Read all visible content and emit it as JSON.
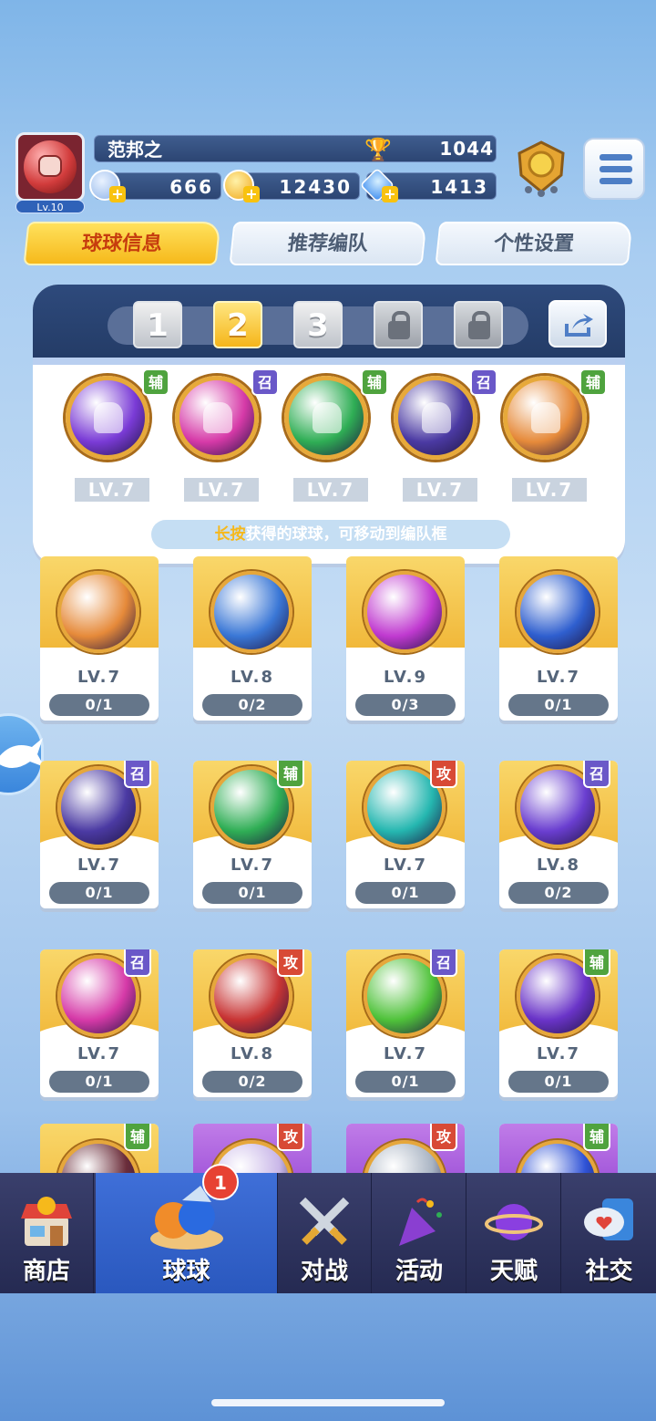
{
  "player": {
    "name": "范邦之",
    "level": "Lv.10",
    "trophies": "1044",
    "energy": "666",
    "gold": "12430",
    "gems": "1413"
  },
  "tabs": [
    {
      "label": "球球信息",
      "active": true
    },
    {
      "label": "推荐编队",
      "active": false
    },
    {
      "label": "个性设置",
      "active": false
    }
  ],
  "team": {
    "slots": [
      "1",
      "2",
      "3",
      "",
      ""
    ],
    "active_slot": "2",
    "balls": [
      {
        "tag": "辅",
        "level": "LV.7",
        "color": "#7a3bd6"
      },
      {
        "tag": "召",
        "level": "LV.7",
        "color": "#d63aa8"
      },
      {
        "tag": "辅",
        "level": "LV.7",
        "color": "#2fae55"
      },
      {
        "tag": "召",
        "level": "LV.7",
        "color": "#4b3aa3"
      },
      {
        "tag": "辅",
        "level": "LV.7",
        "color": "#e68a3a"
      }
    ],
    "hint_bold": "长按",
    "hint_rest": "获得的球球，可移动到编队框"
  },
  "cards": [
    {
      "tag": "",
      "level": "LV.7",
      "progress": "0/1",
      "color": "#e68a3a"
    },
    {
      "tag": "",
      "level": "LV.8",
      "progress": "0/2",
      "color": "#3a77d6"
    },
    {
      "tag": "",
      "level": "LV.9",
      "progress": "0/3",
      "color": "#c03ad0"
    },
    {
      "tag": "",
      "level": "LV.7",
      "progress": "0/1",
      "color": "#2f5fcf"
    },
    {
      "tag": "召",
      "level": "LV.7",
      "progress": "0/1",
      "color": "#4b3aa3"
    },
    {
      "tag": "辅",
      "level": "LV.7",
      "progress": "0/1",
      "color": "#2fae55"
    },
    {
      "tag": "攻",
      "level": "LV.7",
      "progress": "0/1",
      "color": "#25b7b0"
    },
    {
      "tag": "召",
      "level": "LV.8",
      "progress": "0/2",
      "color": "#6a3ed0"
    },
    {
      "tag": "召",
      "level": "LV.7",
      "progress": "0/1",
      "color": "#d63aa8"
    },
    {
      "tag": "攻",
      "level": "LV.8",
      "progress": "0/2",
      "color": "#c83434"
    },
    {
      "tag": "召",
      "level": "LV.7",
      "progress": "0/1",
      "color": "#4fc23a"
    },
    {
      "tag": "辅",
      "level": "LV.7",
      "progress": "0/1",
      "color": "#6a34c8"
    },
    {
      "tag": "辅",
      "level": "",
      "progress": "",
      "color": "#6b2d3a"
    },
    {
      "tag": "攻",
      "level": "",
      "progress": "",
      "color": "#c9b7e8"
    },
    {
      "tag": "攻",
      "level": "",
      "progress": "",
      "color": "#a9b4c3"
    },
    {
      "tag": "辅",
      "level": "",
      "progress": "",
      "color": "#2f52d6"
    }
  ],
  "nav": {
    "badge_count": "1",
    "items": [
      {
        "label": "商店",
        "icon": "shop-icon"
      },
      {
        "label": "球球",
        "icon": "ball-icon",
        "active": true
      },
      {
        "label": "对战",
        "icon": "swords-icon"
      },
      {
        "label": "活动",
        "icon": "party-popper-icon"
      },
      {
        "label": "天赋",
        "icon": "planet-icon"
      },
      {
        "label": "社交",
        "icon": "chat-icon"
      }
    ]
  },
  "colors": {
    "accent_gold": "#f6b91b",
    "nav_bg": "#252a52",
    "nav_active": "#2a58be"
  }
}
